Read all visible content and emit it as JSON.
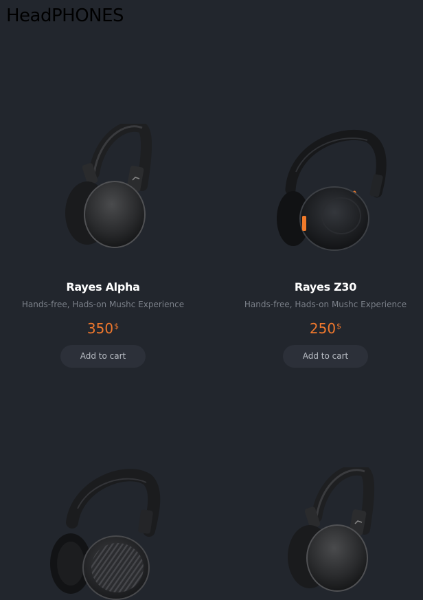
{
  "header": {
    "title": "HeadPHONES"
  },
  "products": [
    {
      "name": "Rayes Alpha",
      "description": "Hands-free, Hads-on Mushc Experience",
      "price": "350",
      "currency": "$",
      "button_label": "Add to cart",
      "image": "over-ear-headphones-black-image"
    },
    {
      "name": "Rayes Z30",
      "description": "Hands-free, Hads-on Mushc Experience",
      "price": "250",
      "currency": "$",
      "button_label": "Add to cart",
      "image": "on-ear-headphones-black-orange-image"
    },
    {
      "image": "over-ear-headphones-black-textured-image"
    },
    {
      "image": "over-ear-headphones-black-image"
    }
  ],
  "colors": {
    "background": "#22262d",
    "title": "#000000",
    "product_name": "#ffffff",
    "description": "#7b8089",
    "price": "#f0782d",
    "button_bg": "#2c3039",
    "button_text": "#b9bdc4"
  }
}
